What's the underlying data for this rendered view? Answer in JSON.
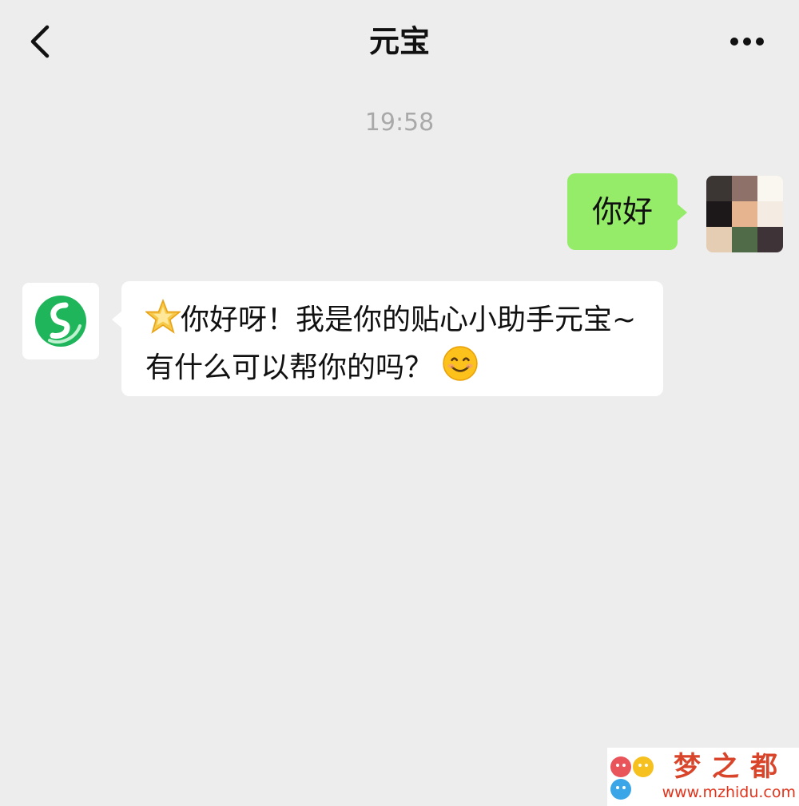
{
  "header": {
    "back_icon": "chevron-left-icon",
    "title": "元宝",
    "more_icon": "more-horizontal-icon"
  },
  "chat": {
    "timestamp": "19:58",
    "sent": {
      "text": "你好",
      "bubble_color": "#95ec69"
    },
    "received": {
      "leading_emoji": "🌟",
      "text": "你好呀！我是你的贴心小助手元宝~有什么可以帮你的吗？",
      "trailing_emoji": "😊",
      "bubble_color": "#ffffff"
    },
    "bot_avatar_icon": "yuanbao-logo-icon",
    "bot_logo_color": "#1fb55a"
  },
  "watermark": {
    "name": "梦之都",
    "url": "www.mzhidu.com",
    "color": "#d8452a"
  }
}
